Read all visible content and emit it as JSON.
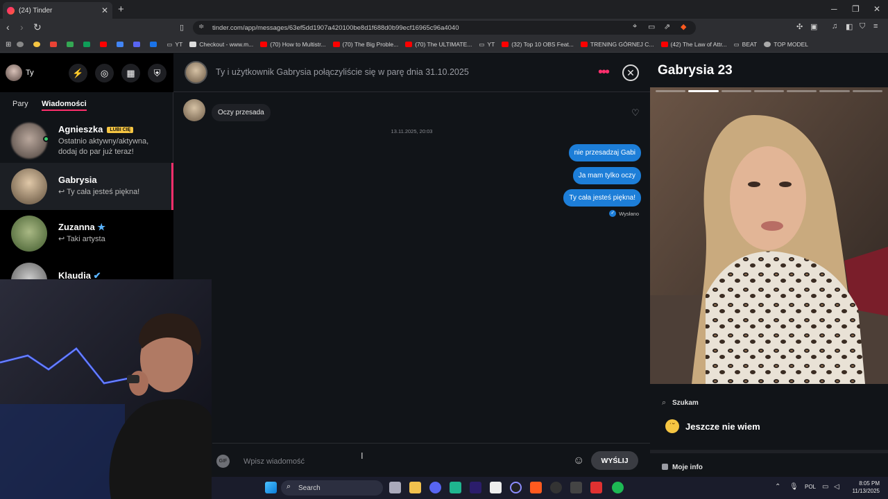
{
  "browser": {
    "tab_title": "(24) Tinder",
    "url": "tinder.com/app/messages/63ef5dd1907a420100be8d1f688d0b99ecf16965c96a4040",
    "bookmarks": [
      "YT",
      "Checkout - www.m...",
      "(70) How to Multistr...",
      "(70) The Big Proble...",
      "(70) The ULTIMATE...",
      "YT",
      "(32) Top 10 OBS Feat...",
      "TRENING GÓRNEJ C...",
      "(42) The Law of Attr...",
      "BEAT",
      "TOP MODEL"
    ]
  },
  "sidebar": {
    "me_label": "Ty",
    "tabs": [
      "Pary",
      "Wiadomości"
    ],
    "active_tab": "Wiadomości",
    "conversations": [
      {
        "name": "Agnieszka",
        "badge": "LUBI CIĘ",
        "preview": "Ostatnio aktywny/aktywna, dodaj do par już teraz!"
      },
      {
        "name": "Gabrysia",
        "preview": "↩ Ty cała jesteś piękna!"
      },
      {
        "name": "Zuzanna",
        "preview": "↩ Taki artysta"
      },
      {
        "name": "Klaudia",
        "preview": ""
      }
    ]
  },
  "chat": {
    "match_text": "Ty i użytkownik Gabrysia połączyliście się w parę dnia 31.10.2025",
    "incoming": "Oczy przesada",
    "timestamp": "13.11.2025, 20:03",
    "outgoing": [
      "nie przesadzaj Gabi",
      "Ja mam tylko oczy",
      "Ty cała jesteś piękna!"
    ],
    "status": "Wysłano",
    "input_placeholder": "Wpisz wiadomość",
    "send_label": "WYŚLIJ",
    "gif_label": "GIF"
  },
  "profile": {
    "name_age": "Gabrysia 23",
    "photo_count": 7,
    "photo_active": 2,
    "looking_label": "Szukam",
    "looking_value": "Jeszcze nie wiem",
    "more_info": "Moje info"
  },
  "taskbar": {
    "search": "Search",
    "lang": "POL",
    "time": "8:05 PM",
    "date": "11/13/2025"
  },
  "colors": {
    "tinder_pink": "#fd2f6c",
    "bubble_blue": "#1d7ed8",
    "background": "#111418"
  }
}
